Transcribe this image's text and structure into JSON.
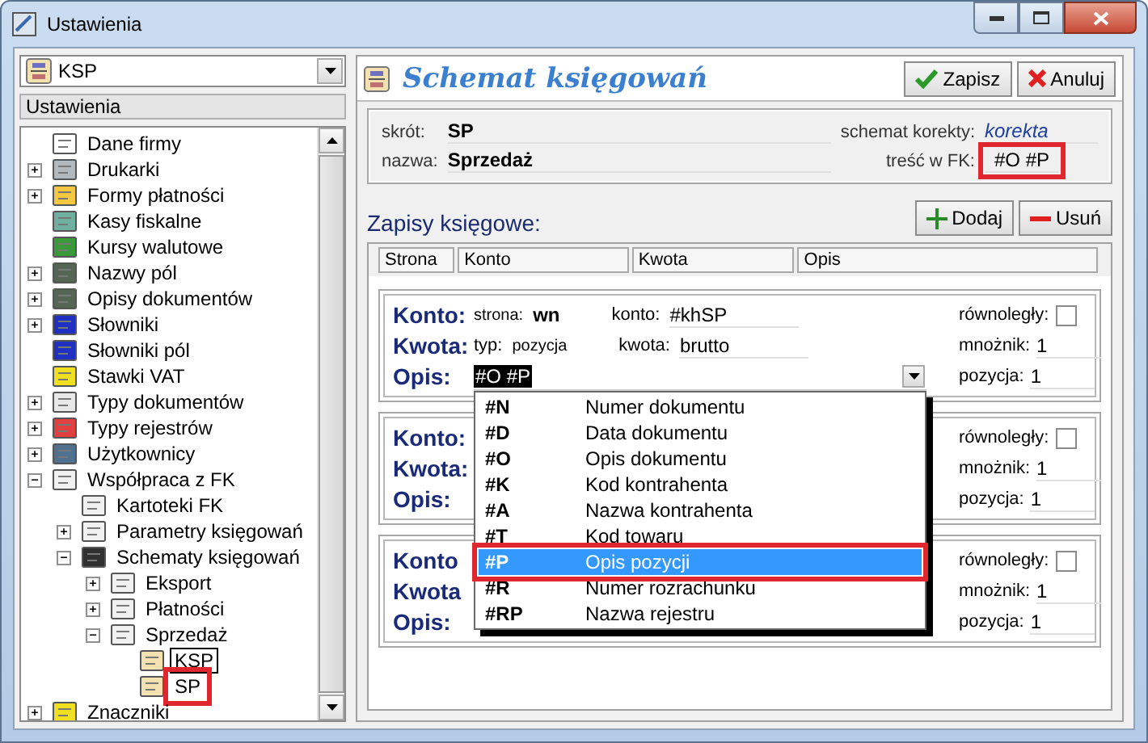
{
  "window": {
    "title": "Ustawienia"
  },
  "sidebar": {
    "combo": {
      "value": "KSP"
    },
    "header": "Ustawienia",
    "tree": [
      {
        "label": "Dane firmy",
        "selected": false,
        "highlighted": false
      },
      {
        "label": "Drukarki",
        "expanded": false,
        "selected": false,
        "highlighted": false
      },
      {
        "label": "Formy płatności",
        "expanded": false,
        "selected": false,
        "highlighted": false
      },
      {
        "label": "Kasy fiskalne",
        "selected": false,
        "highlighted": false
      },
      {
        "label": "Kursy walutowe",
        "selected": false,
        "highlighted": false
      },
      {
        "label": "Nazwy pól",
        "expanded": false,
        "selected": false,
        "highlighted": false
      },
      {
        "label": "Opisy dokumentów",
        "expanded": false,
        "selected": false,
        "highlighted": false
      },
      {
        "label": "Słowniki",
        "expanded": false,
        "selected": false,
        "highlighted": false
      },
      {
        "label": "Słowniki pól",
        "selected": false,
        "highlighted": false
      },
      {
        "label": "Stawki VAT",
        "selected": false,
        "highlighted": false
      },
      {
        "label": "Typy dokumentów",
        "expanded": false,
        "selected": false,
        "highlighted": false
      },
      {
        "label": "Typy rejestrów",
        "expanded": false,
        "selected": false,
        "highlighted": false
      },
      {
        "label": "Użytkownicy",
        "expanded": false,
        "selected": false,
        "highlighted": false
      },
      {
        "label": "Współpraca z FK",
        "expanded": true,
        "selected": false,
        "highlighted": false,
        "children": [
          {
            "label": "Kartoteki FK",
            "selected": false,
            "highlighted": false
          },
          {
            "label": "Parametry księgowań",
            "expanded": false,
            "selected": false,
            "highlighted": false
          },
          {
            "label": "Schematy księgowań",
            "expanded": true,
            "selected": false,
            "highlighted": false,
            "children": [
              {
                "label": "Eksport",
                "expanded": false,
                "selected": false,
                "highlighted": false
              },
              {
                "label": "Płatności",
                "expanded": false,
                "selected": false,
                "highlighted": false
              },
              {
                "label": "Sprzedaż",
                "expanded": true,
                "selected": false,
                "highlighted": false,
                "children": [
                  {
                    "label": "KSP",
                    "selected": true,
                    "highlighted": false
                  },
                  {
                    "label": "SP",
                    "selected": false,
                    "highlighted": true
                  }
                ]
              }
            ]
          }
        ]
      },
      {
        "label": "Znaczniki",
        "expanded": false,
        "selected": false,
        "highlighted": false
      }
    ]
  },
  "editor": {
    "title": "Schemat księgowań",
    "buttons": [
      {
        "label": "Zapisz",
        "kind": "save"
      },
      {
        "label": "Anuluj",
        "kind": "cancel"
      }
    ],
    "fields": {
      "skrot": {
        "label": "skrót:",
        "value": "SP"
      },
      "nazwa": {
        "label": "nazwa:",
        "value": "Sprzedaż"
      },
      "korekta": {
        "label": "schemat korekty:",
        "value": "korekta"
      },
      "tresc": {
        "label": "treść w FK:",
        "value": "#O #P",
        "highlighted": true
      }
    },
    "entries_title": "Zapisy księgowe:",
    "entry_buttons": [
      {
        "label": "Dodaj",
        "kind": "add"
      },
      {
        "label": "Usuń",
        "kind": "remove"
      }
    ],
    "columns": [
      "Strona",
      "Konto",
      "Kwota",
      "Opis"
    ],
    "entries": [
      {
        "konto": {
          "label": "Konto:",
          "strona_label": "strona:",
          "strona": "wn",
          "konto_label": "konto:",
          "konto": "#khSP"
        },
        "kwota": {
          "label": "Kwota:",
          "typ_label": "typ:",
          "typ": "pozycja",
          "kwota_label": "kwota:",
          "kwota": "brutto"
        },
        "opis": {
          "label": "Opis:",
          "value": "#O #P",
          "text_selected": true
        },
        "rownolegly": {
          "label": "równoległy:",
          "checked": false
        },
        "mnoznik": {
          "label": "mnożnik:",
          "value": "1"
        },
        "pozycja": {
          "label": "pozycja:",
          "value": "1"
        }
      },
      {
        "konto": {
          "label": "Konto:"
        },
        "kwota": {
          "label": "Kwota:"
        },
        "opis": {
          "label": "Opis:"
        },
        "rownolegly": {
          "label": "równoległy:",
          "checked": false
        },
        "mnoznik": {
          "label": "mnożnik:",
          "value": "1"
        },
        "pozycja": {
          "label": "pozycja:",
          "value": "1"
        }
      },
      {
        "konto": {
          "label": "Konto"
        },
        "kwota": {
          "label": "Kwota"
        },
        "opis": {
          "label": "Opis:"
        },
        "rownolegly": {
          "label": "równoległy:",
          "checked": false
        },
        "mnoznik": {
          "label": "mnożnik:",
          "value": "1"
        },
        "pozycja": {
          "label": "pozycja:",
          "value": "1"
        }
      }
    ],
    "dropdown": {
      "items": [
        {
          "code": "#N",
          "label": "Numer dokumentu",
          "selected": false,
          "highlighted": false
        },
        {
          "code": "#D",
          "label": "Data dokumentu",
          "selected": false,
          "highlighted": false
        },
        {
          "code": "#O",
          "label": "Opis dokumentu",
          "selected": false,
          "highlighted": false
        },
        {
          "code": "#K",
          "label": "Kod kontrahenta",
          "selected": false,
          "highlighted": false
        },
        {
          "code": "#A",
          "label": "Nazwa kontrahenta",
          "selected": false,
          "highlighted": false
        },
        {
          "code": "#T",
          "label": "Kod towaru",
          "selected": false,
          "highlighted": false
        },
        {
          "code": "#P",
          "label": "Opis pozycji",
          "selected": true,
          "highlighted": true
        },
        {
          "code": "#R",
          "label": "Numer rozrachunku",
          "selected": false,
          "highlighted": false
        },
        {
          "code": "#RP",
          "label": "Nazwa rejestru",
          "selected": false,
          "highlighted": false
        }
      ]
    }
  }
}
